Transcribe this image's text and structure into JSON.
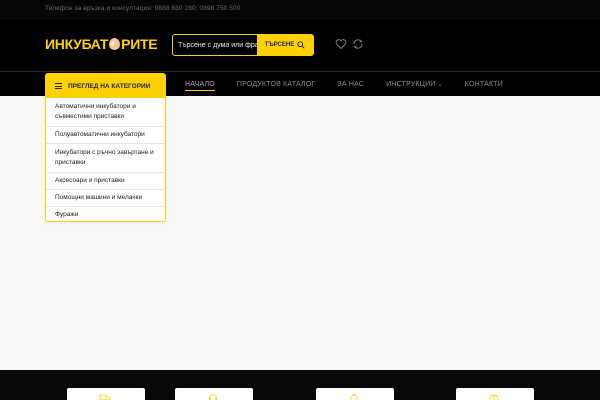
{
  "topbar": {
    "phones": "Телефон за връзка и консултация: 0888 630 280; 0898 750 500"
  },
  "header": {
    "logo_part1": "ИНКУБАТ",
    "logo_part2": "РИТЕ",
    "search_placeholder": "Търсене с дума или фраза",
    "search_button": "ТЪРСЕНЕ"
  },
  "nav": {
    "items": [
      {
        "label": "НАЧАЛО",
        "active": true
      },
      {
        "label": "ПРОДУКТОВ КАТАЛОГ"
      },
      {
        "label": "ЗА НАС"
      },
      {
        "label": "ИНСТРУКЦИИ",
        "has_dropdown": true
      },
      {
        "label": "КОНТАКТИ"
      }
    ]
  },
  "categories": {
    "title": "ПРЕГЛЕД НА КАТЕГОРИИ",
    "items": [
      "Автоматични инкубатори и съвместими приставки",
      "Полуавтоматични инкубатори",
      "Инкубатори с ръчно завъртане и приставки",
      "Аксесоари и приставки",
      "Помощни машини и мелачки",
      "Фуражи"
    ]
  },
  "colors": {
    "accent": "#fed103",
    "header_bg": "#000000",
    "page_bg": "#f9f9f9"
  },
  "icons": [
    "search-icon",
    "heart-icon",
    "compare-icon",
    "menu-icon",
    "truck-icon",
    "support-icon",
    "apple-icon",
    "gift-icon"
  ]
}
